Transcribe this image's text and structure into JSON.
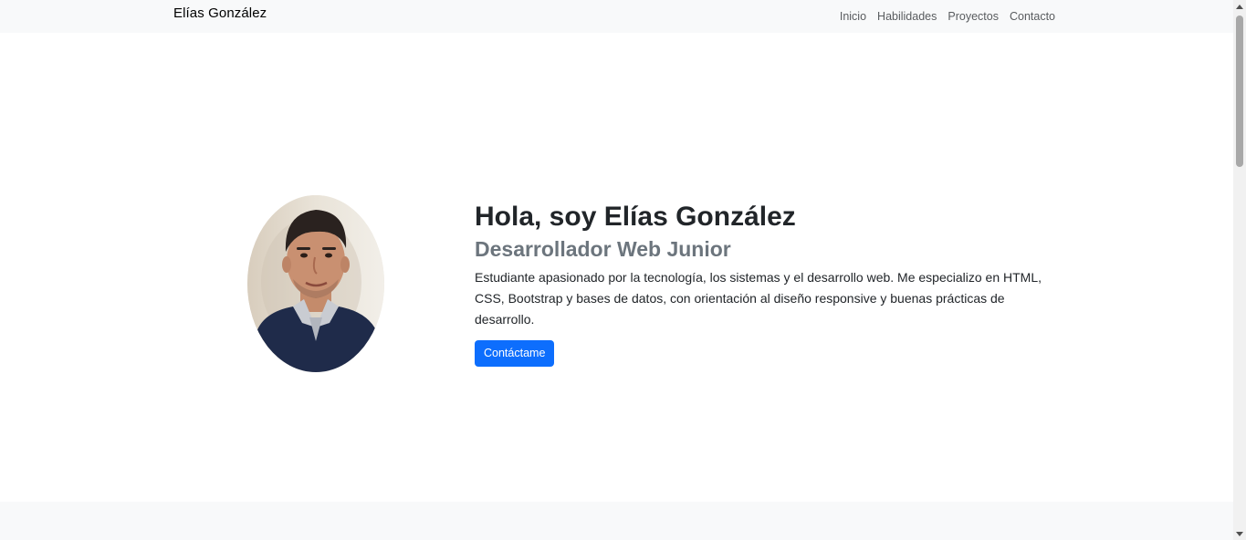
{
  "navbar": {
    "brand": "Elías González",
    "links": [
      {
        "label": "Inicio"
      },
      {
        "label": "Habilidades"
      },
      {
        "label": "Proyectos"
      },
      {
        "label": "Contacto"
      }
    ]
  },
  "hero": {
    "photo_alt": "Elías González",
    "title": "Hola, soy Elías González",
    "subtitle": "Desarrollador Web Junior",
    "description": "Estudiante apasionado por la tecnología, los sistemas y el desarrollo web. Me especializo en HTML, CSS, Bootstrap y bases de datos, con orientación al diseño responsive y buenas prácticas de desarrollo.",
    "cta_label": "Contáctame"
  },
  "colors": {
    "primary": "#0d6efd",
    "navbar_bg": "#f8f9fa",
    "subtitle": "#6c757d",
    "text": "#212529"
  }
}
